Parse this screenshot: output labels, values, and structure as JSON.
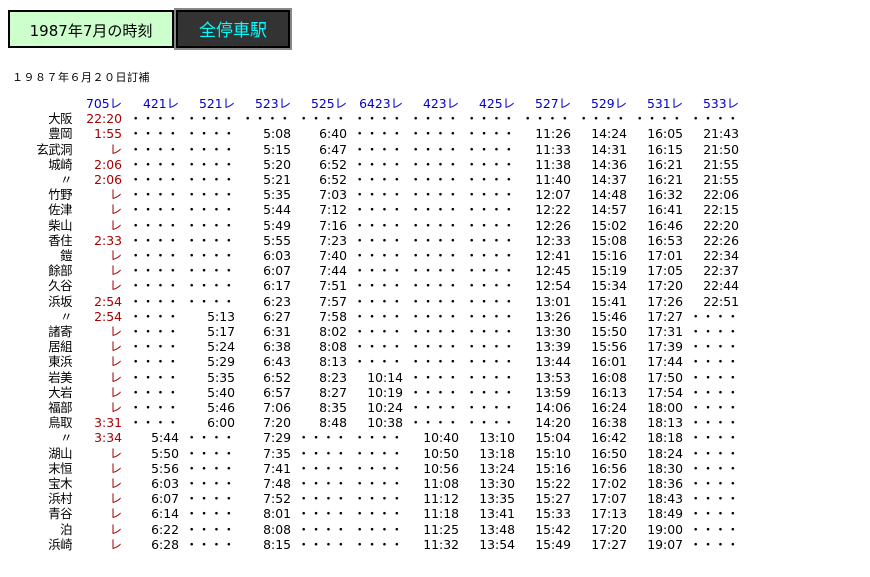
{
  "header": {
    "month_label": "1987年7月の時刻",
    "station_label": "全停車駅"
  },
  "revision_note": "１９８７年６月２０日訂補",
  "columns": [
    "705レ",
    "421レ",
    "521レ",
    "523レ",
    "525レ",
    "6423レ",
    "423レ",
    "425レ",
    "527レ",
    "529レ",
    "531レ",
    "533レ"
  ],
  "rows": [
    {
      "station": "大阪",
      "times": [
        "22:20",
        "・・・・",
        "・・・・",
        "・・・・",
        "・・・・",
        "・・・・",
        "・・・・",
        "・・・・",
        "・・・・",
        "・・・・",
        "・・・・",
        "・・・・"
      ]
    },
    {
      "station": "豊岡",
      "times": [
        "1:55",
        "・・・・",
        "・・・・",
        "5:08",
        "6:40",
        "・・・・",
        "・・・・",
        "・・・・",
        "11:26",
        "14:24",
        "16:05",
        "21:43"
      ]
    },
    {
      "station": "玄武洞",
      "times": [
        "レ",
        "・・・・",
        "・・・・",
        "5:15",
        "6:47",
        "・・・・",
        "・・・・",
        "・・・・",
        "11:33",
        "14:31",
        "16:15",
        "21:50"
      ]
    },
    {
      "station": "城崎",
      "times": [
        "2:06",
        "・・・・",
        "・・・・",
        "5:20",
        "6:52",
        "・・・・",
        "・・・・",
        "・・・・",
        "11:38",
        "14:36",
        "16:21",
        "21:55"
      ]
    },
    {
      "station": "〃",
      "times": [
        "2:06",
        "・・・・",
        "・・・・",
        "5:21",
        "6:52",
        "・・・・",
        "・・・・",
        "・・・・",
        "11:40",
        "14:37",
        "16:21",
        "21:55"
      ]
    },
    {
      "station": "竹野",
      "times": [
        "レ",
        "・・・・",
        "・・・・",
        "5:35",
        "7:03",
        "・・・・",
        "・・・・",
        "・・・・",
        "12:07",
        "14:48",
        "16:32",
        "22:06"
      ]
    },
    {
      "station": "佐津",
      "times": [
        "レ",
        "・・・・",
        "・・・・",
        "5:44",
        "7:12",
        "・・・・",
        "・・・・",
        "・・・・",
        "12:22",
        "14:57",
        "16:41",
        "22:15"
      ]
    },
    {
      "station": "柴山",
      "times": [
        "レ",
        "・・・・",
        "・・・・",
        "5:49",
        "7:16",
        "・・・・",
        "・・・・",
        "・・・・",
        "12:26",
        "15:02",
        "16:46",
        "22:20"
      ]
    },
    {
      "station": "香住",
      "times": [
        "2:33",
        "・・・・",
        "・・・・",
        "5:55",
        "7:23",
        "・・・・",
        "・・・・",
        "・・・・",
        "12:33",
        "15:08",
        "16:53",
        "22:26"
      ]
    },
    {
      "station": "鎧",
      "times": [
        "レ",
        "・・・・",
        "・・・・",
        "6:03",
        "7:40",
        "・・・・",
        "・・・・",
        "・・・・",
        "12:41",
        "15:16",
        "17:01",
        "22:34"
      ]
    },
    {
      "station": "餘部",
      "times": [
        "レ",
        "・・・・",
        "・・・・",
        "6:07",
        "7:44",
        "・・・・",
        "・・・・",
        "・・・・",
        "12:45",
        "15:19",
        "17:05",
        "22:37"
      ]
    },
    {
      "station": "久谷",
      "times": [
        "レ",
        "・・・・",
        "・・・・",
        "6:17",
        "7:51",
        "・・・・",
        "・・・・",
        "・・・・",
        "12:54",
        "15:34",
        "17:20",
        "22:44"
      ]
    },
    {
      "station": "浜坂",
      "times": [
        "2:54",
        "・・・・",
        "・・・・",
        "6:23",
        "7:57",
        "・・・・",
        "・・・・",
        "・・・・",
        "13:01",
        "15:41",
        "17:26",
        "22:51"
      ]
    },
    {
      "station": "〃",
      "times": [
        "2:54",
        "・・・・",
        "5:13",
        "6:27",
        "7:58",
        "・・・・",
        "・・・・",
        "・・・・",
        "13:26",
        "15:46",
        "17:27",
        "・・・・"
      ]
    },
    {
      "station": "諸寄",
      "times": [
        "レ",
        "・・・・",
        "5:17",
        "6:31",
        "8:02",
        "・・・・",
        "・・・・",
        "・・・・",
        "13:30",
        "15:50",
        "17:31",
        "・・・・"
      ]
    },
    {
      "station": "居組",
      "times": [
        "レ",
        "・・・・",
        "5:24",
        "6:38",
        "8:08",
        "・・・・",
        "・・・・",
        "・・・・",
        "13:39",
        "15:56",
        "17:39",
        "・・・・"
      ]
    },
    {
      "station": "東浜",
      "times": [
        "レ",
        "・・・・",
        "5:29",
        "6:43",
        "8:13",
        "・・・・",
        "・・・・",
        "・・・・",
        "13:44",
        "16:01",
        "17:44",
        "・・・・"
      ]
    },
    {
      "station": "岩美",
      "times": [
        "レ",
        "・・・・",
        "5:35",
        "6:52",
        "8:23",
        "10:14",
        "・・・・",
        "・・・・",
        "13:53",
        "16:08",
        "17:50",
        "・・・・"
      ]
    },
    {
      "station": "大岩",
      "times": [
        "レ",
        "・・・・",
        "5:40",
        "6:57",
        "8:27",
        "10:19",
        "・・・・",
        "・・・・",
        "13:59",
        "16:13",
        "17:54",
        "・・・・"
      ]
    },
    {
      "station": "福部",
      "times": [
        "レ",
        "・・・・",
        "5:46",
        "7:06",
        "8:35",
        "10:24",
        "・・・・",
        "・・・・",
        "14:06",
        "16:24",
        "18:00",
        "・・・・"
      ]
    },
    {
      "station": "鳥取",
      "times": [
        "3:31",
        "・・・・",
        "6:00",
        "7:20",
        "8:48",
        "10:38",
        "・・・・",
        "・・・・",
        "14:20",
        "16:38",
        "18:13",
        "・・・・"
      ]
    },
    {
      "station": "〃",
      "times": [
        "3:34",
        "5:44",
        "・・・・",
        "7:29",
        "・・・・",
        "・・・・",
        "10:40",
        "13:10",
        "15:04",
        "16:42",
        "18:18",
        "・・・・"
      ]
    },
    {
      "station": "湖山",
      "times": [
        "レ",
        "5:50",
        "・・・・",
        "7:35",
        "・・・・",
        "・・・・",
        "10:50",
        "13:18",
        "15:10",
        "16:50",
        "18:24",
        "・・・・"
      ]
    },
    {
      "station": "末恒",
      "times": [
        "レ",
        "5:56",
        "・・・・",
        "7:41",
        "・・・・",
        "・・・・",
        "10:56",
        "13:24",
        "15:16",
        "16:56",
        "18:30",
        "・・・・"
      ]
    },
    {
      "station": "宝木",
      "times": [
        "レ",
        "6:03",
        "・・・・",
        "7:48",
        "・・・・",
        "・・・・",
        "11:08",
        "13:30",
        "15:22",
        "17:02",
        "18:36",
        "・・・・"
      ]
    },
    {
      "station": "浜村",
      "times": [
        "レ",
        "6:07",
        "・・・・",
        "7:52",
        "・・・・",
        "・・・・",
        "11:12",
        "13:35",
        "15:27",
        "17:07",
        "18:43",
        "・・・・"
      ]
    },
    {
      "station": "青谷",
      "times": [
        "レ",
        "6:14",
        "・・・・",
        "8:01",
        "・・・・",
        "・・・・",
        "11:18",
        "13:41",
        "15:33",
        "17:13",
        "18:49",
        "・・・・"
      ]
    },
    {
      "station": "泊",
      "times": [
        "レ",
        "6:22",
        "・・・・",
        "8:08",
        "・・・・",
        "・・・・",
        "11:25",
        "13:48",
        "15:42",
        "17:20",
        "19:00",
        "・・・・"
      ]
    },
    {
      "station": "浜崎",
      "times": [
        "レ",
        "6:28",
        "・・・・",
        "8:15",
        "・・・・",
        "・・・・",
        "11:32",
        "13:54",
        "15:49",
        "17:27",
        "19:07",
        "・・・・"
      ]
    }
  ],
  "colors": {
    "header_month_bg": "#ccffcc",
    "header_station_bg": "#333333",
    "header_station_text": "#00ffff",
    "column_header_text": "#0000cc",
    "express_time_text": "#aa0000"
  }
}
